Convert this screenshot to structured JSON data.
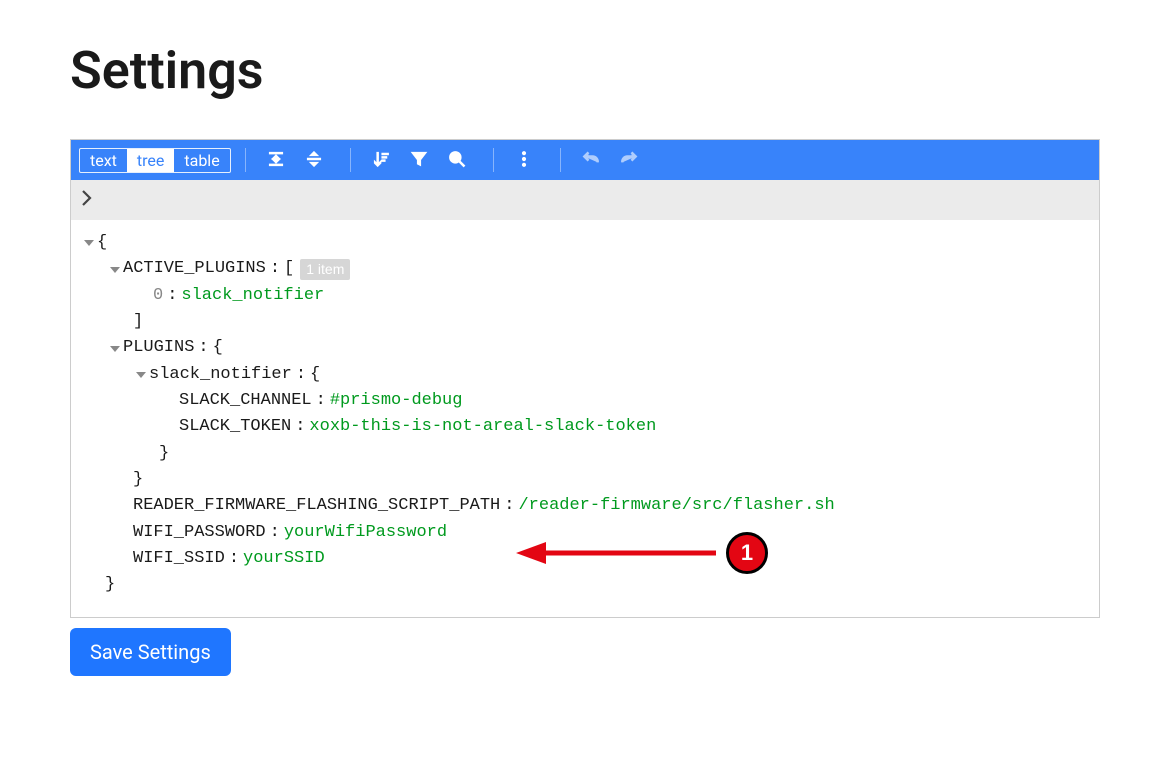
{
  "page": {
    "title": "Settings",
    "save_button": "Save Settings"
  },
  "toolbar": {
    "modes": {
      "text": "text",
      "tree": "tree",
      "table": "table"
    },
    "active_mode": "tree"
  },
  "tree": {
    "root_open": "{",
    "root_close": "}",
    "active_plugins": {
      "key": "ACTIVE_PLUGINS",
      "open": "[",
      "count": "1 item",
      "items": [
        {
          "index": "0",
          "value": "slack_notifier"
        }
      ],
      "close": "]"
    },
    "plugins": {
      "key": "PLUGINS",
      "open": "{",
      "slack_notifier": {
        "key": "slack_notifier",
        "open": "{",
        "channel_key": "SLACK_CHANNEL",
        "channel_val": "#prismo-debug",
        "token_key": "SLACK_TOKEN",
        "token_val": "xoxb-this-is-not-areal-slack-token",
        "close": "}"
      },
      "close": "}"
    },
    "reader_path": {
      "key": "READER_FIRMWARE_FLASHING_SCRIPT_PATH",
      "val": "/reader-firmware/src/flasher.sh"
    },
    "wifi_password": {
      "key": "WIFI_PASSWORD",
      "val": "yourWifiPassword"
    },
    "wifi_ssid": {
      "key": "WIFI_SSID",
      "val": "yourSSID"
    }
  },
  "annotation": {
    "number": "1"
  }
}
